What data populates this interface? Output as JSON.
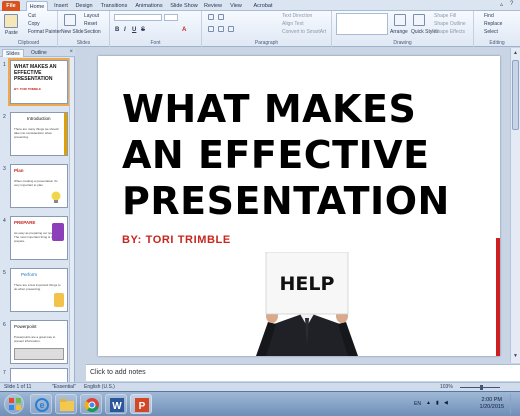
{
  "ribbon": {
    "tabs": [
      "File",
      "Home",
      "Insert",
      "Design",
      "Transitions",
      "Animations",
      "Slide Show",
      "Review",
      "View",
      "Acrobat"
    ],
    "groups": {
      "clipboard": "Clipboard",
      "slides": "Slides",
      "font": "Font",
      "paragraph": "Paragraph",
      "drawing": "Drawing",
      "editing": "Editing"
    },
    "clipboard": {
      "paste": "Paste",
      "cut": "Cut",
      "copy": "Copy",
      "format_painter": "Format Painter"
    },
    "slides": {
      "new_slide": "New Slide",
      "layout": "Layout",
      "reset": "Reset",
      "section": "Section"
    },
    "paragraph": {
      "text_direction": "Text Direction",
      "align_text": "Align Text",
      "convert": "Convert to SmartArt"
    },
    "drawing": {
      "arrange": "Arrange",
      "quick_styles": "Quick Styles",
      "shape_fill": "Shape Fill",
      "shape_outline": "Shape Outline",
      "shape_effects": "Shape Effects"
    },
    "editing": {
      "find": "Find",
      "replace": "Replace",
      "select": "Select"
    }
  },
  "panel": {
    "tabs": [
      "Slides",
      "Outline"
    ],
    "thumbnails": [
      {
        "num": "1",
        "title": "WHAT MAKES AN EFFECTIVE PRESENTATION",
        "body": "BY: TORI TRIMBLE"
      },
      {
        "num": "2",
        "title": "Introduction",
        "body": "There are many things we should take into consideration when presenting."
      },
      {
        "num": "3",
        "title": "Plan",
        "body": "When creating a presentation it's very important to plan."
      },
      {
        "num": "4",
        "title": "PREPARE",
        "body": "As easy as preparing our speech. The most important thing is to prepare."
      },
      {
        "num": "5",
        "title": "Perform",
        "body": "There are a few important things to do when presenting."
      },
      {
        "num": "6",
        "title": "Powerpoint",
        "body": "Powerpoints are a great way to present information."
      },
      {
        "num": "7",
        "title": "",
        "body": ""
      }
    ]
  },
  "slide": {
    "title_lines": [
      "WHAT MAKES",
      "AN EFFECTIVE",
      "PRESENTATION"
    ],
    "subtitle": "BY: TORI TRIMBLE",
    "help_sign": "HELP"
  },
  "notes_placeholder": "Click to add notes",
  "status": {
    "slide": "Slide 1 of 11",
    "theme": "\"Essential\"",
    "language": "English (U.S.)",
    "zoom": "103%"
  },
  "tray": {
    "lang": "EN",
    "time": "2:00 PM",
    "date": "1/20/2015"
  },
  "colors": {
    "title": "#000000",
    "subtitle": "#c8251e",
    "accent_bar": "#cc1f1f",
    "file_tab": "#d9531e"
  }
}
